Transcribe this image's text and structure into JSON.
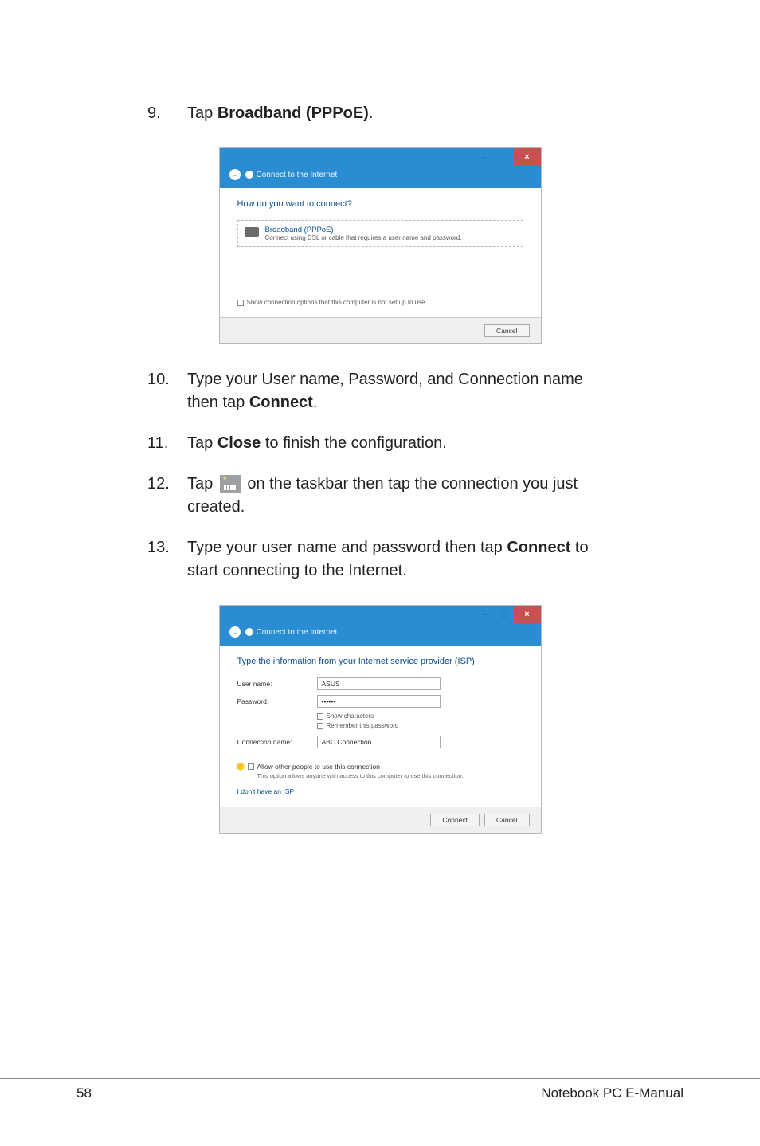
{
  "steps": {
    "s9": {
      "num": "9.",
      "pre": "Tap ",
      "bold": "Broadband (PPPoE)",
      "post": "."
    },
    "s10": {
      "num": "10.",
      "pre": "Type your User name, Password, and Connection name then tap ",
      "bold": "Connect",
      "post": "."
    },
    "s11": {
      "num": "11.",
      "pre": "Tap ",
      "bold": "Close",
      "post": " to finish the configuration."
    },
    "s12": {
      "num": "12.",
      "pre": "Tap ",
      "post1": " on the taskbar then tap the connection you just created."
    },
    "s13": {
      "num": "13.",
      "pre": "Type your user name and password then tap ",
      "bold": "Connect",
      "post": " to start connecting to the Internet."
    }
  },
  "dialog1": {
    "breadcrumb": "Connect to the Internet",
    "heading": "How do you want to connect?",
    "option_title": "Broadband (PPPoE)",
    "option_sub": "Connect using DSL or cable that requires a user name and password.",
    "show_opts": "Show connection options that this computer is not set up to use",
    "cancel": "Cancel"
  },
  "dialog2": {
    "breadcrumb": "Connect to the Internet",
    "heading": "Type the information from your Internet service provider (ISP)",
    "username_label": "User name:",
    "username_value": "ASUS",
    "password_label": "Password:",
    "password_value": "••••••",
    "show_chars": "Show characters",
    "remember_pw": "Remember this password",
    "connname_label": "Connection name:",
    "connname_value": "ABC Connection",
    "allow_label": "Allow other people to use this connection",
    "allow_sub": "This option allows anyone with access to this computer to use this connection.",
    "isp_link": "I don't have an ISP",
    "connect": "Connect",
    "cancel": "Cancel"
  },
  "footer": {
    "page": "58",
    "title": "Notebook PC E-Manual"
  }
}
